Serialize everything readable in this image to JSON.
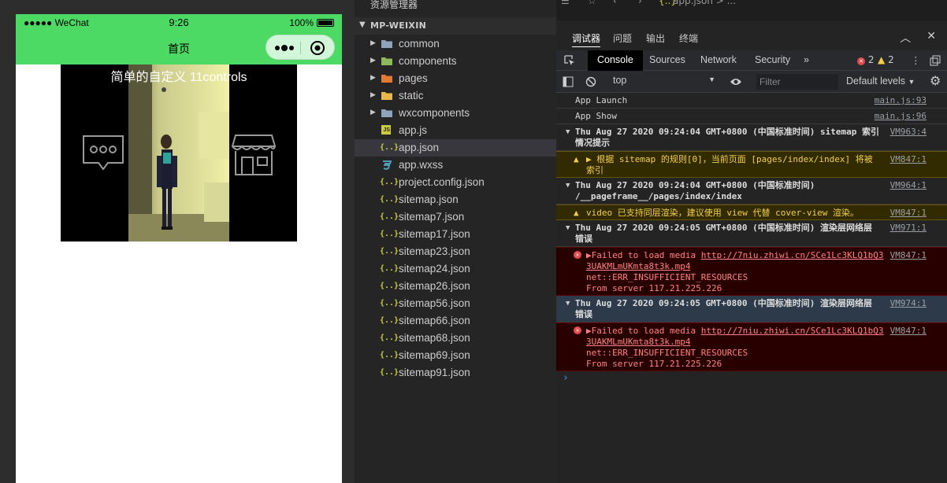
{
  "simulator": {
    "status_left": "●●●●● WeChat",
    "time": "9:26",
    "battery": "100%",
    "nav_title": "首页",
    "video_title": "简单的自定义 11controls"
  },
  "explorer": {
    "title": "资源管理器",
    "project": "MP-WEIXIN",
    "items": [
      {
        "label": "common",
        "type": "folder"
      },
      {
        "label": "components",
        "type": "folder"
      },
      {
        "label": "pages",
        "type": "folder"
      },
      {
        "label": "static",
        "type": "folder"
      },
      {
        "label": "wxcomponents",
        "type": "folder"
      },
      {
        "label": "app.js",
        "type": "js"
      },
      {
        "label": "app.json",
        "type": "json"
      },
      {
        "label": "app.wxss",
        "type": "css"
      },
      {
        "label": "project.config.json",
        "type": "json"
      },
      {
        "label": "sitemap.json",
        "type": "json"
      },
      {
        "label": "sitemap7.json",
        "type": "json"
      },
      {
        "label": "sitemap17.json",
        "type": "json"
      },
      {
        "label": "sitemap23.json",
        "type": "json"
      },
      {
        "label": "sitemap24.json",
        "type": "json"
      },
      {
        "label": "sitemap26.json",
        "type": "json"
      },
      {
        "label": "sitemap56.json",
        "type": "json"
      },
      {
        "label": "sitemap66.json",
        "type": "json"
      },
      {
        "label": "sitemap68.json",
        "type": "json"
      },
      {
        "label": "sitemap69.json",
        "type": "json"
      },
      {
        "label": "sitemap91.json",
        "type": "json"
      }
    ]
  },
  "editor": {
    "breadcrumb": "app.json > ..."
  },
  "panel": {
    "tabs": [
      "调试器",
      "问题",
      "输出",
      "终端"
    ]
  },
  "devtools": {
    "tabs": [
      "Console",
      "Sources",
      "Network",
      "Security"
    ],
    "errors": "2",
    "warnings": "2",
    "context": "top",
    "filter_placeholder": "Filter",
    "levels": "Default levels"
  },
  "console": {
    "app_launch": "App Launch",
    "app_launch_src": "main.js:93",
    "app_show": "App Show",
    "app_show_src": "main.js:96",
    "g1_title": "Thu Aug 27 2020 09:24:04 GMT+0800 (中国标准时间) sitemap 索引\n情况提示",
    "g1_src": "VM963:4",
    "w1": "▶ 根据 sitemap 的规则[0]，当前页面 [pages/index/index] 将被\n索引",
    "w1_src": "VM847:1",
    "g2_title": "Thu Aug 27 2020 09:24:04 GMT+0800 (中国标准时间)\n/__pageframe__/pages/index/index",
    "g2_src": "VM964:1",
    "w2": "video 已支持同层渲染，建议使用 view 代替 cover-view 渲染。",
    "w2_src": "VM847:1",
    "g3_title": "Thu Aug 27 2020 09:24:05 GMT+0800 (中国标准时间) 渲染层网络层\n错误",
    "g3_src": "VM971:1",
    "e_prefix": "▶Failed to load media ",
    "e_link": "http://7niu.zhiwi.cn/SCe1Lc3KLQ1bQ3\n3UAKMLmUKmta8t3k.mp4",
    "e_rest": "\nnet::ERR_INSUFFICIENT_RESOURCES\nFrom server 117.21.225.226",
    "e1_src": "VM847:1",
    "g4_title": "Thu Aug 27 2020 09:24:05 GMT+0800 (中国标准时间) 渲染层网络层\n错误",
    "g4_src": "VM974:1",
    "e2_src": "VM847:1",
    "prompt": "›"
  }
}
